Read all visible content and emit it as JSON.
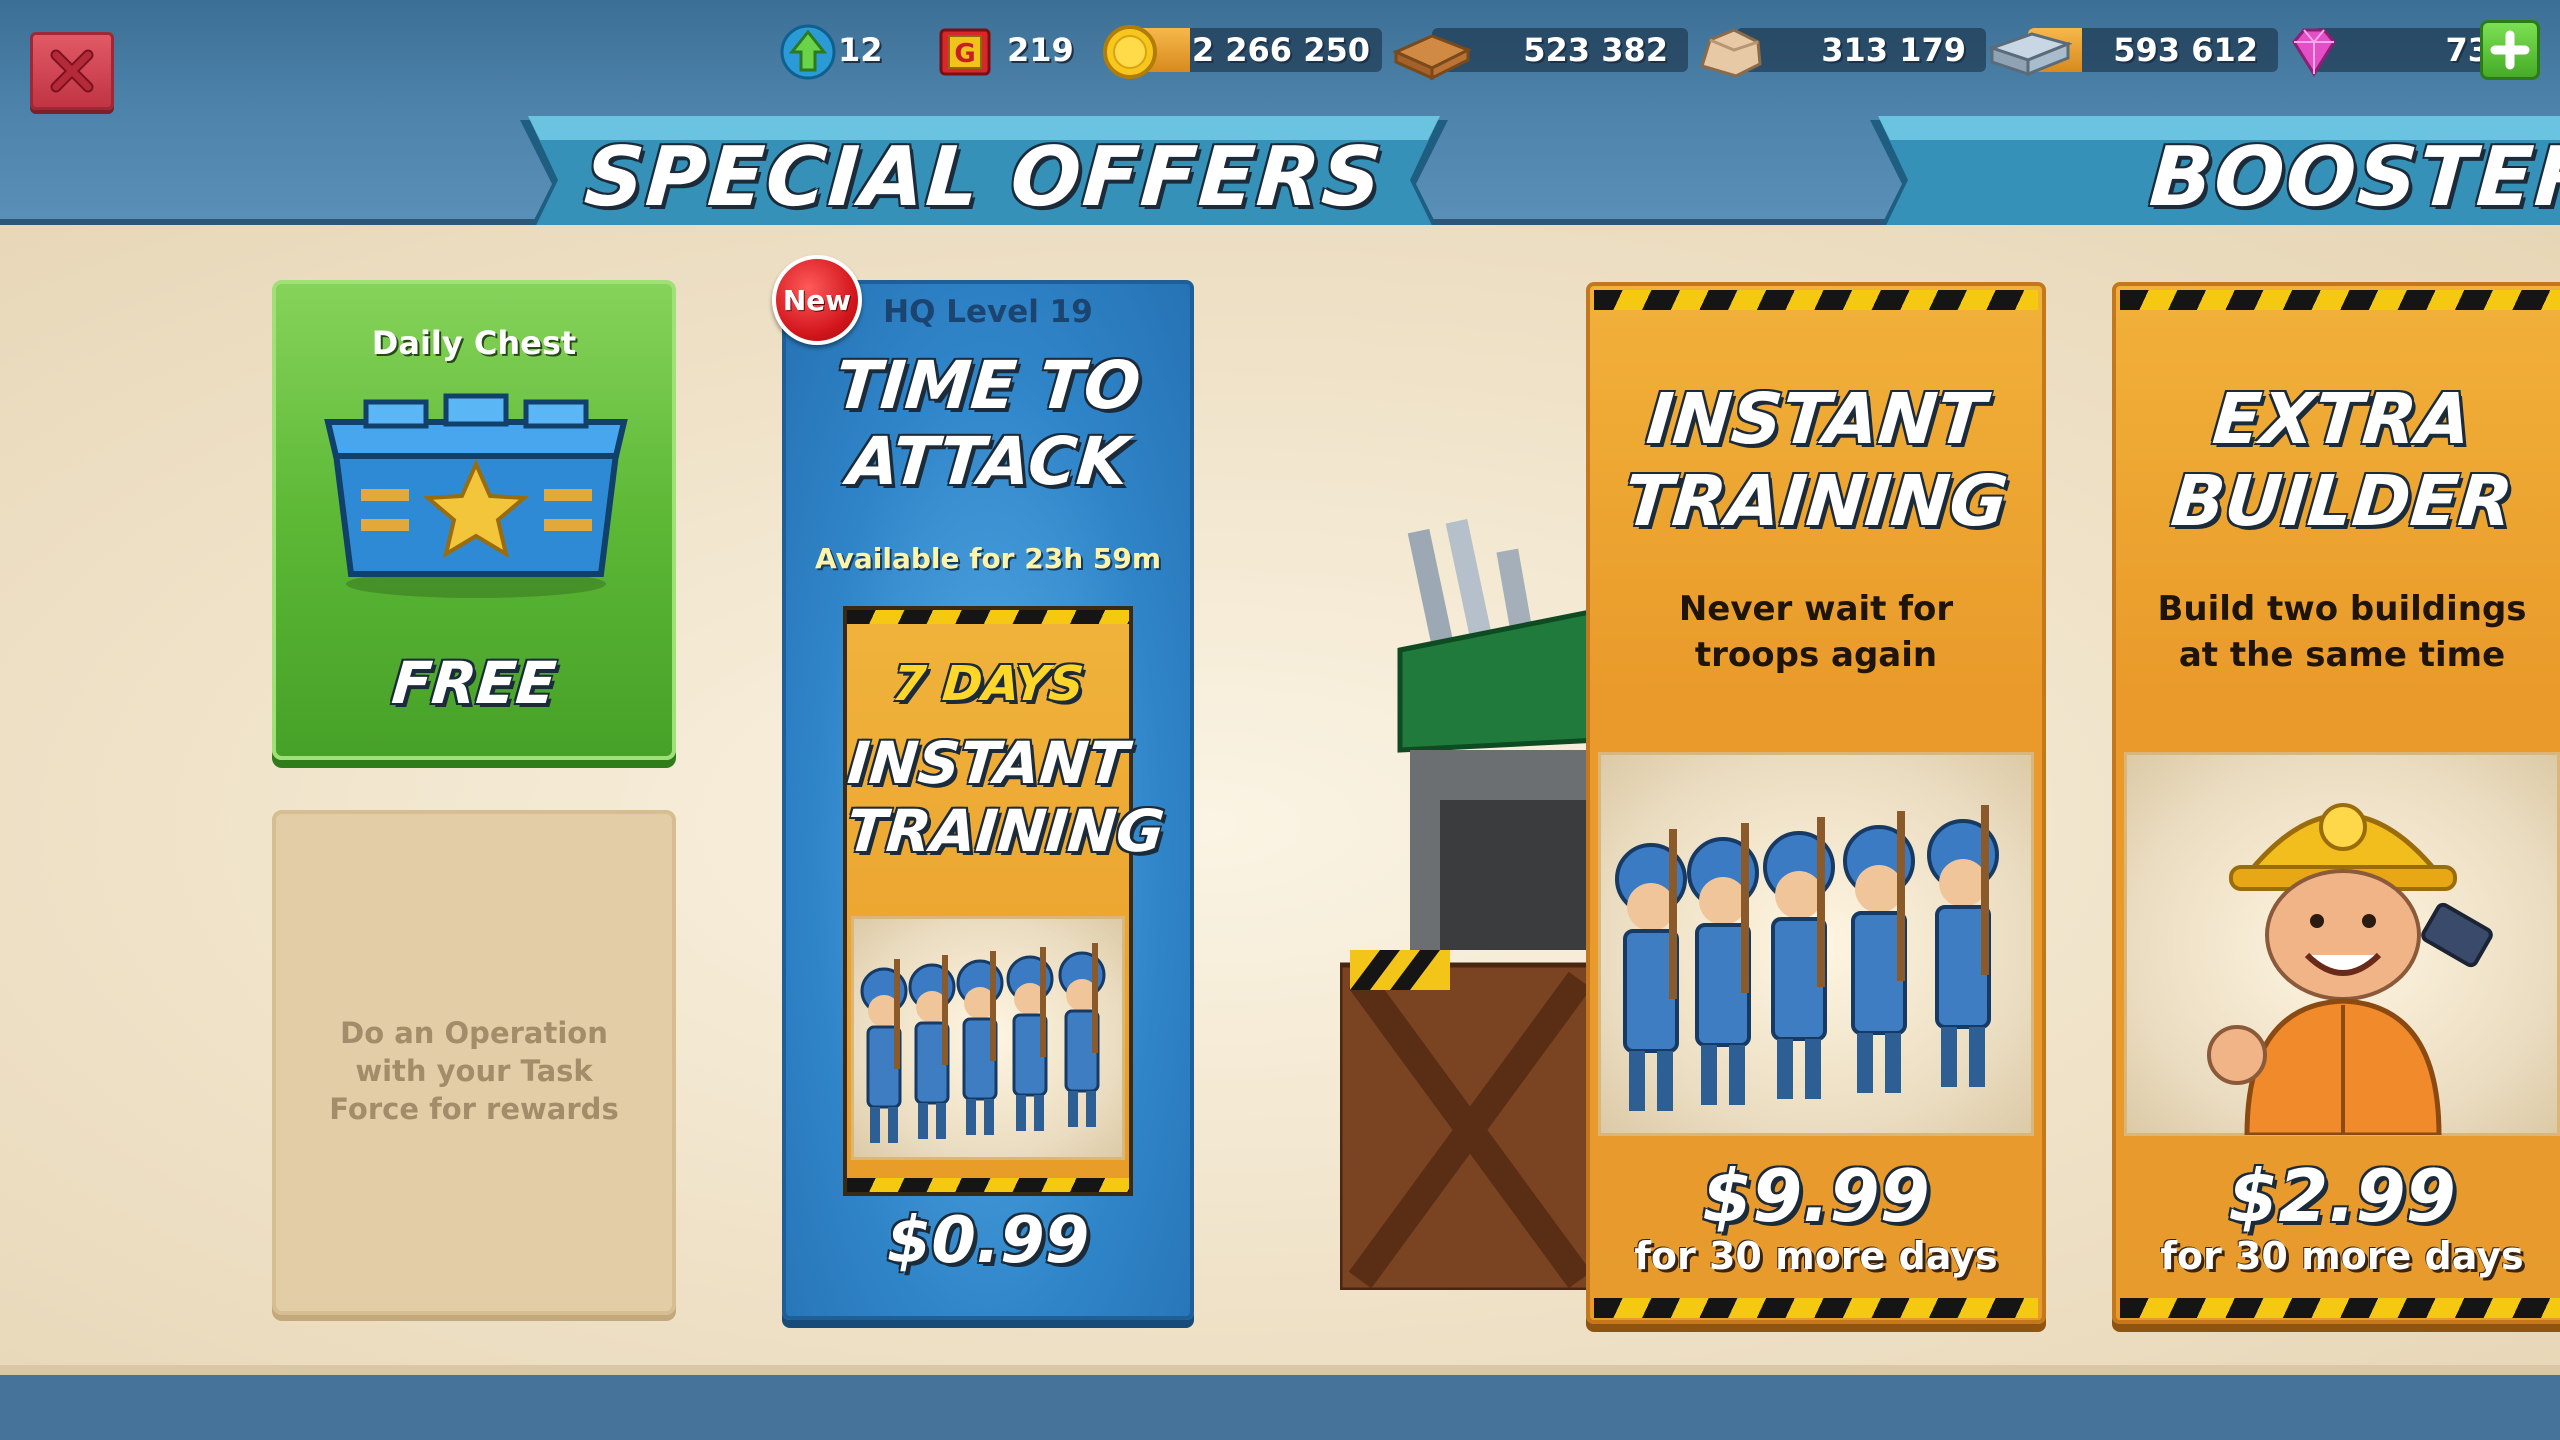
{
  "resources": {
    "level": "12",
    "intel": "219",
    "gold": "2 266 250",
    "wood": "523 382",
    "stone": "313 179",
    "iron": "593 612",
    "diamonds": "73"
  },
  "banners": {
    "special_offers": "SPECIAL OFFERS",
    "boosters": "BOOSTERS"
  },
  "daily_chest": {
    "title": "Daily Chest",
    "price_label": "FREE"
  },
  "operation_card": {
    "message": "Do an Operation with your Task Force for rewards"
  },
  "time_to_attack": {
    "badge": "New",
    "level": "HQ Level 19",
    "title_line1": "TIME TO",
    "title_line2": "ATTACK",
    "availability": "Available for 23h 59m",
    "days": "7 DAYS",
    "offer_line1": "INSTANT",
    "offer_line2": "TRAINING",
    "price": "$0.99"
  },
  "boosters": [
    {
      "title_line1": "INSTANT",
      "title_line2": "TRAINING",
      "desc_line1": "Never wait for",
      "desc_line2": "troops again",
      "price": "$9.99",
      "price_note": "for 30 more days"
    },
    {
      "title_line1": "EXTRA",
      "title_line2": "BUILDER",
      "desc_line1": "Build two buildings",
      "desc_line2": "at the same time",
      "price": "$2.99",
      "price_note": "for 30 more days"
    }
  ],
  "icons": {
    "close": "close-icon",
    "level": "level-up-arrow-icon",
    "intel": "intel-icon",
    "gold": "gold-coin-icon",
    "wood": "wood-icon",
    "stone": "stone-icon",
    "iron": "iron-icon",
    "diamonds": "diamond-icon",
    "add": "plus-icon"
  },
  "colors": {
    "topbar": "#4f85ad",
    "banner": "#3591b8",
    "green_card": "#5cb835",
    "blue_card": "#2f85c8",
    "orange_card": "#e99a2a",
    "close_button": "#d04452",
    "add_button": "#5cc33a"
  }
}
